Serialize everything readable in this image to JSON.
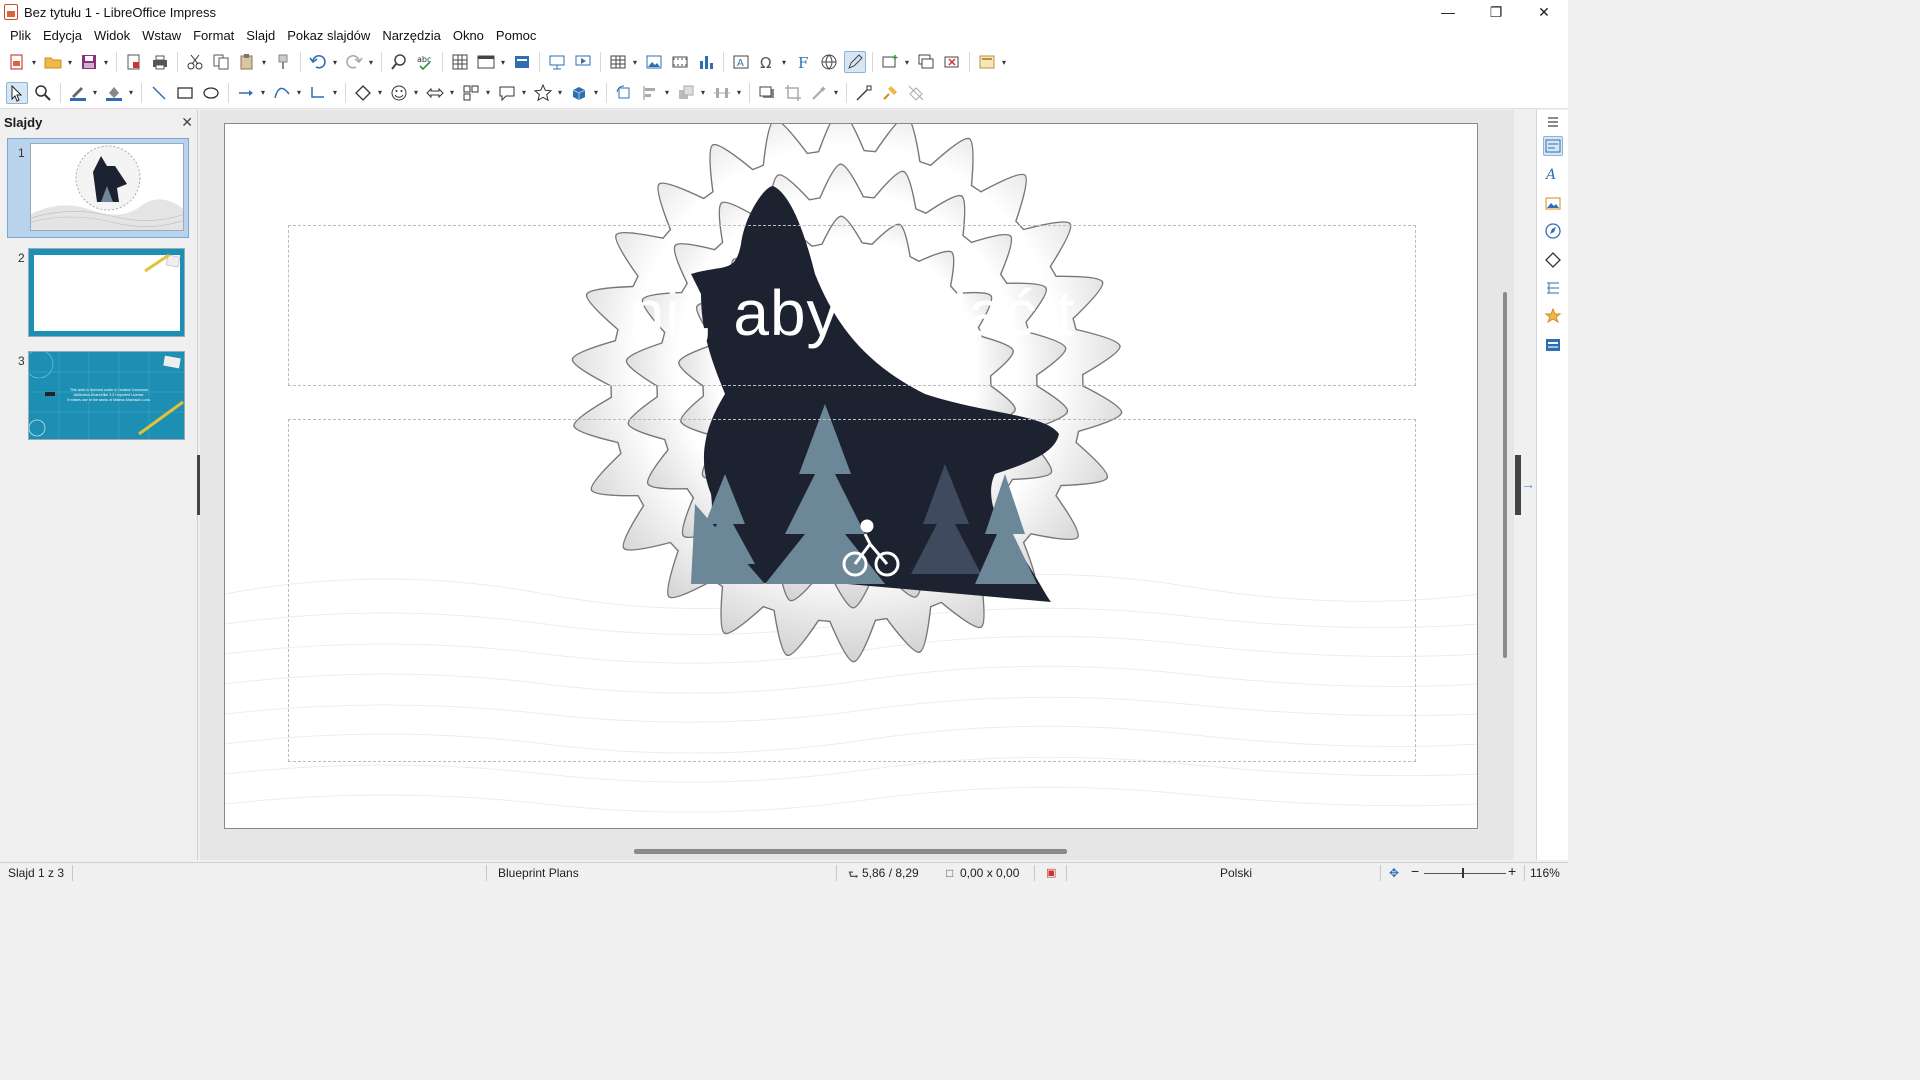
{
  "window": {
    "title": "Bez tytułu 1 - LibreOffice Impress",
    "controls": [
      "minimize",
      "restore",
      "close"
    ]
  },
  "menu": [
    {
      "label": "Plik"
    },
    {
      "label": "Edycja"
    },
    {
      "label": "Widok"
    },
    {
      "label": "Wstaw"
    },
    {
      "label": "Format"
    },
    {
      "label": "Slajd"
    },
    {
      "label": "Pokaz slajdów"
    },
    {
      "label": "Narzędzia"
    },
    {
      "label": "Okno"
    },
    {
      "label": "Pomoc"
    }
  ],
  "slide_pane": {
    "title": "Slajdy",
    "slides": [
      {
        "number": "1",
        "selected": true
      },
      {
        "number": "2",
        "selected": false
      },
      {
        "number": "3",
        "selected": false,
        "caption_lines": [
          "This work is licensed under a Creative Commons",
          "Attribution-ShareAlike 3.0 Unported License.",
          "It makes use of the works of Mateus Machado Luna."
        ]
      }
    ]
  },
  "slide": {
    "title_visible_text": "nij, aby dodać t"
  },
  "status": {
    "slide_info": "Slajd 1 z 3",
    "master": "Blueprint Plans",
    "position": "5,86 / 8,29",
    "size": "0,00 x 0,00",
    "language": "Polski",
    "zoom": "116%"
  },
  "colors": {
    "accent": "#2a7fb8",
    "wolf": "#1d2230",
    "tree": "#6c8797",
    "thumb_blue": "#1d8fb3"
  }
}
